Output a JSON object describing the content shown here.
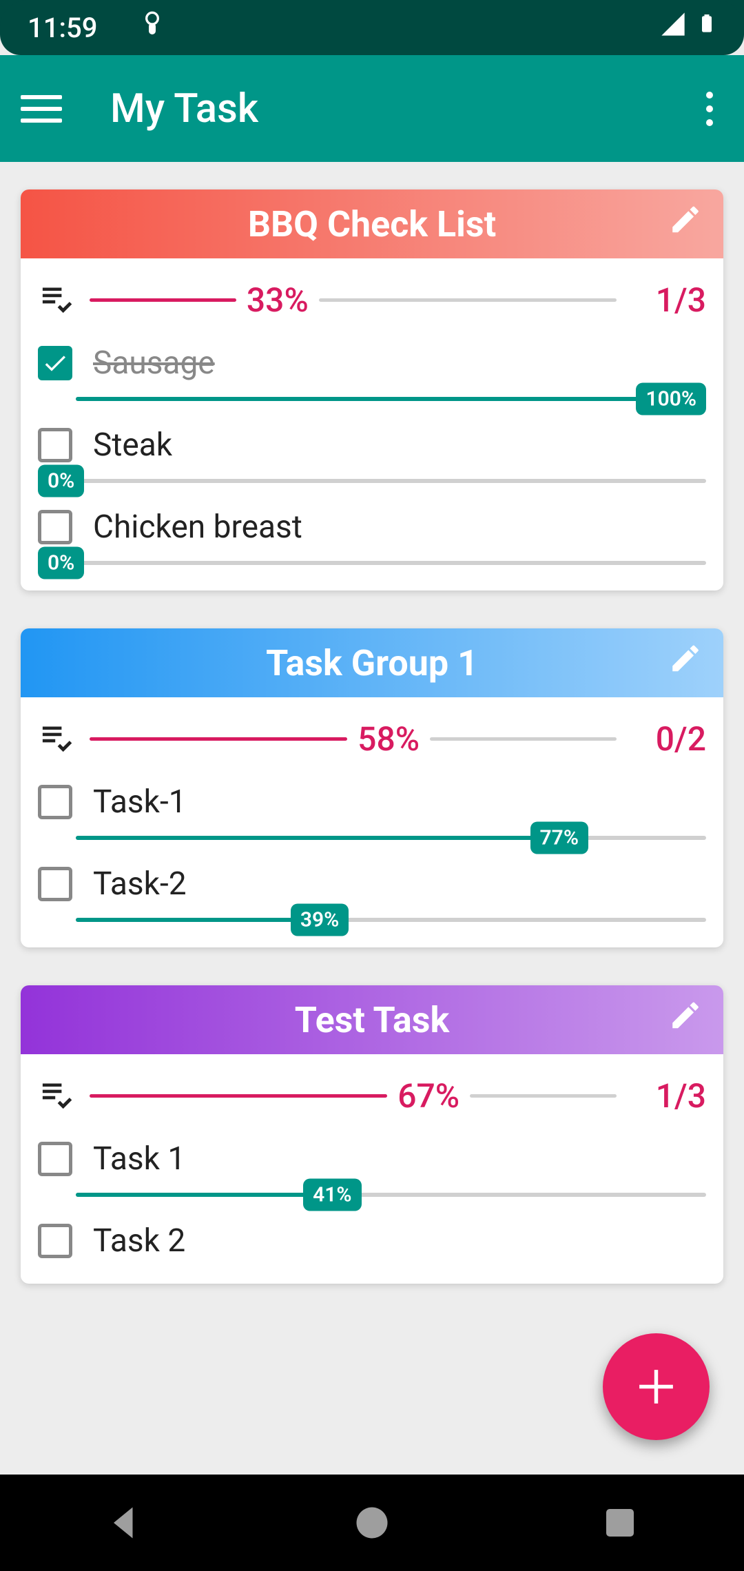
{
  "statusbar": {
    "time": "11:59"
  },
  "appbar": {
    "title": "My Task"
  },
  "colors": {
    "teal": "#009688",
    "pink": "#d81b60",
    "fab": "#e91e63"
  },
  "cards": [
    {
      "title": "BBQ Check List",
      "headerClass": "hdr-red",
      "percent": 33,
      "percent_label": "33%",
      "count_label": "1/3",
      "tasks": [
        {
          "label": "Sausage",
          "checked": true,
          "progress": 100,
          "progress_label": "100%",
          "badge_right": true,
          "indent": true
        },
        {
          "label": "Steak",
          "checked": false,
          "progress": 0,
          "progress_label": "0%",
          "badge_right": false,
          "indent": false
        },
        {
          "label": "Chicken breast",
          "checked": false,
          "progress": 0,
          "progress_label": "0%",
          "badge_right": false,
          "indent": false
        }
      ]
    },
    {
      "title": "Task Group 1",
      "headerClass": "hdr-blue",
      "percent": 58,
      "percent_label": "58%",
      "count_label": "0/2",
      "tasks": [
        {
          "label": "Task-1",
          "checked": false,
          "progress": 77,
          "progress_label": "77%",
          "badge_right": false,
          "indent": true
        },
        {
          "label": "Task-2",
          "checked": false,
          "progress": 39,
          "progress_label": "39%",
          "badge_right": false,
          "indent": true
        }
      ]
    },
    {
      "title": "Test Task",
      "headerClass": "hdr-purple",
      "percent": 67,
      "percent_label": "67%",
      "count_label": "1/3",
      "tasks": [
        {
          "label": "Task 1",
          "checked": false,
          "progress": 41,
          "progress_label": "41%",
          "badge_right": false,
          "indent": true
        },
        {
          "label": "Task 2",
          "checked": false,
          "progress": 0,
          "progress_label": "",
          "badge_right": false,
          "indent": true,
          "hide_subprog": true
        }
      ]
    }
  ]
}
